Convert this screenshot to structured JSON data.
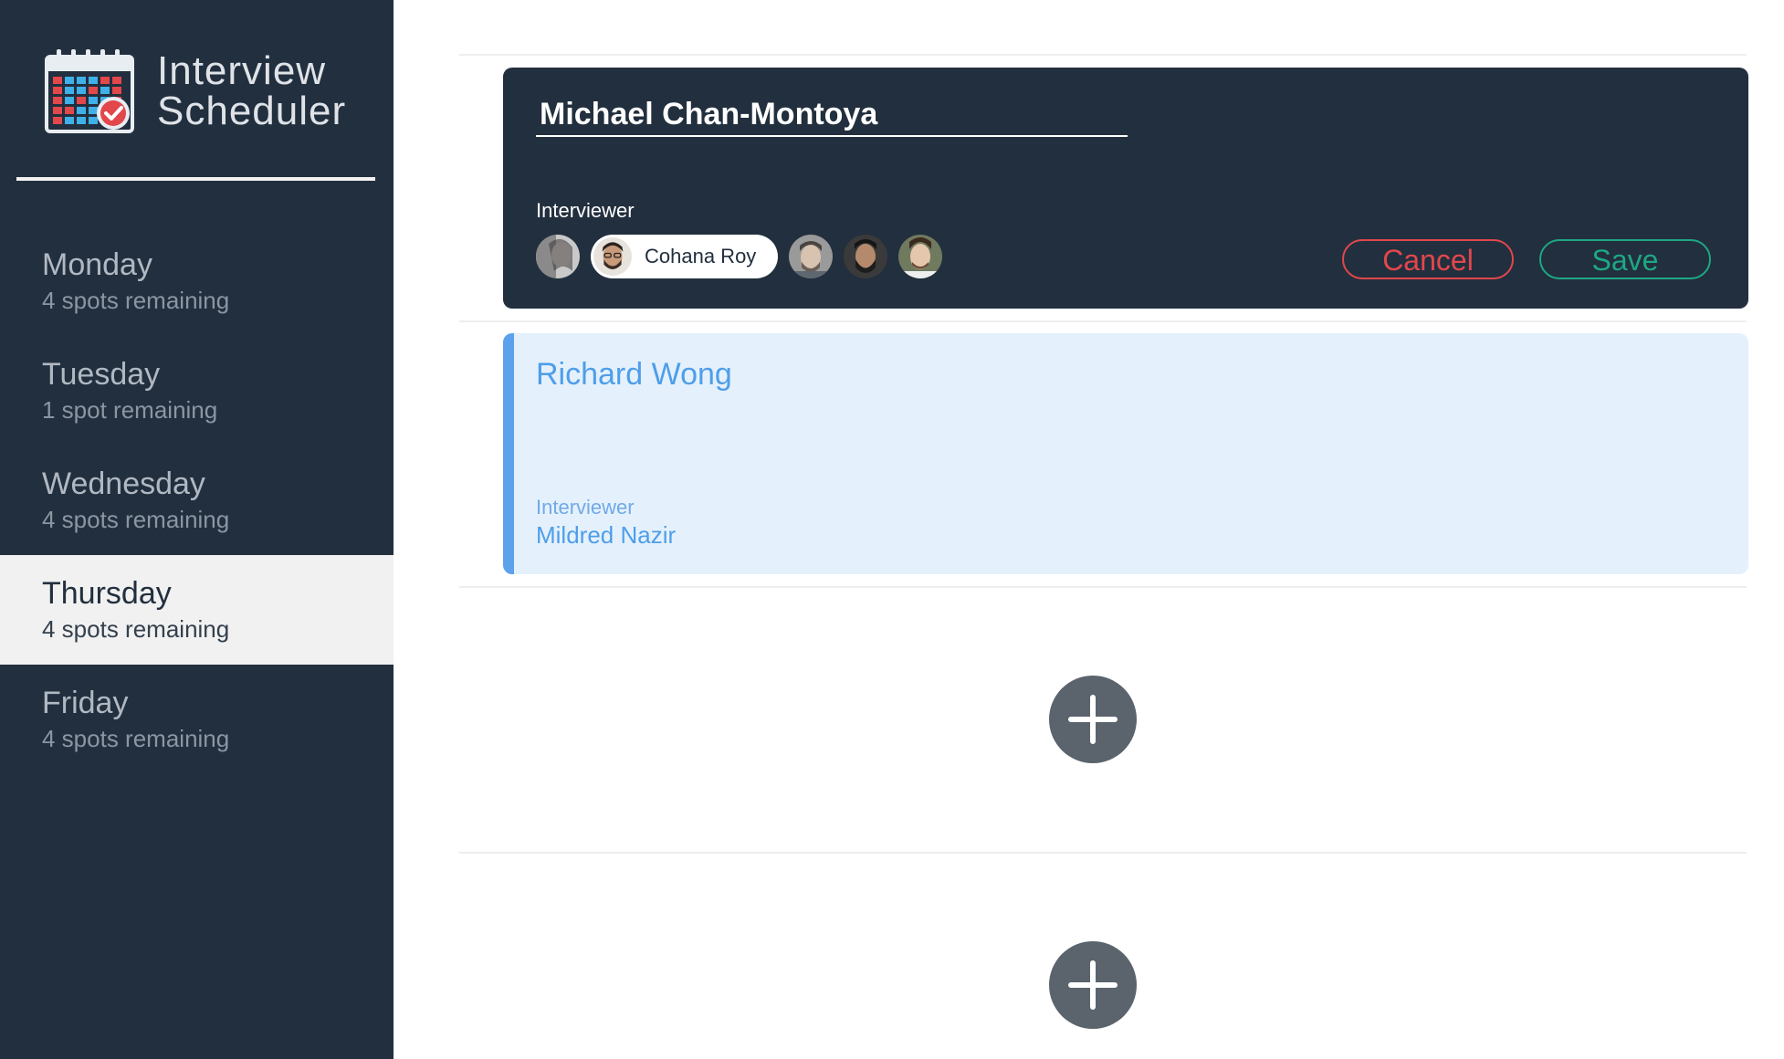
{
  "app": {
    "title_line1": "Interview",
    "title_line2": "Scheduler"
  },
  "sidebar": {
    "days": [
      {
        "name": "Monday",
        "spots": "4 spots remaining"
      },
      {
        "name": "Tuesday",
        "spots": "1 spot remaining"
      },
      {
        "name": "Wednesday",
        "spots": "4 spots remaining"
      },
      {
        "name": "Thursday",
        "spots": "4 spots remaining",
        "selected": true
      },
      {
        "name": "Friday",
        "spots": "4 spots remaining"
      }
    ]
  },
  "edit_form": {
    "student_name": "Michael Chan-Montoya",
    "interviewer_label": "Interviewer",
    "selected_interviewer": "Cohana Roy",
    "cancel_label": "Cancel",
    "save_label": "Save"
  },
  "appointment": {
    "student": "Richard Wong",
    "interviewer_label": "Interviewer",
    "interviewer": "Mildred Nazir"
  },
  "colors": {
    "sidebar_bg": "#222f3e",
    "selected_day_bg": "#f1f1f1",
    "cancel": "#e2474c",
    "save": "#1ea784",
    "appointment_bg": "#e4f1fd",
    "appointment_accent": "#5ba1ec",
    "add_button": "#5b636d"
  },
  "icons": {
    "logo": "calendar-check-icon",
    "add": "plus-icon"
  }
}
